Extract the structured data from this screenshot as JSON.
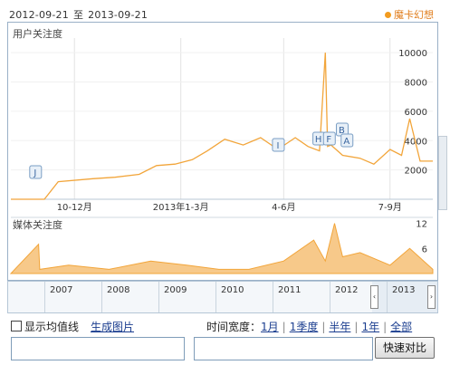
{
  "header": {
    "date_from": "2012-09-21",
    "date_sep": "至",
    "date_to": "2013-09-21",
    "keyword": "魔卡幻想"
  },
  "user_chart": {
    "title": "用户关注度",
    "y_ticks": [
      "10000",
      "8000",
      "6000",
      "4000",
      "2000"
    ],
    "x_ticks": [
      "10-12月",
      "2013年1-3月",
      "4-6月",
      "7-9月"
    ],
    "markers": [
      "J",
      "I",
      "H",
      "F",
      "B",
      "A"
    ]
  },
  "media_chart": {
    "title": "媒体关注度",
    "y_ticks": [
      "12",
      "6"
    ]
  },
  "overview": {
    "years": [
      "2007",
      "2008",
      "2009",
      "2010",
      "2011",
      "2012",
      "2013"
    ]
  },
  "controls": {
    "show_avg": "显示均值线",
    "gen_image": "生成图片",
    "time_width_label": "时间宽度：",
    "ranges": [
      "1月",
      "1季度",
      "半年",
      "1年",
      "全部"
    ],
    "compare_btn": "快速对比",
    "input1_value": "",
    "input2_value": ""
  },
  "chart_data": [
    {
      "type": "line",
      "title": "用户关注度",
      "ylim": [
        0,
        11000
      ],
      "y_ticks": [
        2000,
        4000,
        6000,
        8000,
        10000
      ],
      "x_ticks": [
        "10-12月",
        "2013年1-3月",
        "4-6月",
        "7-9月"
      ],
      "x": [
        "2012-09-21",
        "2012-10-10",
        "2012-10-20",
        "2012-11-01",
        "2012-12-01",
        "2012-12-20",
        "2013-01-10",
        "2013-01-25",
        "2013-02-10",
        "2013-02-25",
        "2013-03-10",
        "2013-03-25",
        "2013-04-10",
        "2013-04-25",
        "2013-05-10",
        "2013-05-25",
        "2013-06-05",
        "2013-06-15",
        "2013-06-20",
        "2013-06-22",
        "2013-06-25",
        "2013-07-05",
        "2013-07-20",
        "2013-08-01",
        "2013-08-15",
        "2013-08-25",
        "2013-09-01",
        "2013-09-10",
        "2013-09-21"
      ],
      "series": [
        {
          "values": [
            0,
            0,
            0,
            1200,
            1400,
            1500,
            1700,
            2300,
            2400,
            2700,
            3300,
            4100,
            3700,
            4200,
            3400,
            4200,
            3600,
            3300,
            10000,
            3600,
            3700,
            3000,
            2800,
            2400,
            3400,
            3000,
            5500,
            2600,
            2600
          ]
        }
      ],
      "markers": [
        {
          "label": "J",
          "x": "2012-10-12"
        },
        {
          "label": "I",
          "x": "2013-05-10"
        },
        {
          "label": "H",
          "x": "2013-06-14"
        },
        {
          "label": "F",
          "x": "2013-06-20"
        },
        {
          "label": "B",
          "x": "2013-06-28"
        },
        {
          "label": "A",
          "x": "2013-06-29"
        }
      ]
    },
    {
      "type": "area",
      "title": "媒体关注度",
      "ylim": [
        0,
        13
      ],
      "y_ticks": [
        6,
        12
      ],
      "x": [
        "2012-09-21",
        "2012-10-15",
        "2012-10-16",
        "2012-11-10",
        "2012-12-15",
        "2013-01-20",
        "2013-02-20",
        "2013-03-20",
        "2013-04-15",
        "2013-05-15",
        "2013-06-10",
        "2013-06-20",
        "2013-06-28",
        "2013-07-05",
        "2013-07-20",
        "2013-08-15",
        "2013-09-01",
        "2013-09-21"
      ],
      "series": [
        {
          "values": [
            0,
            7,
            1,
            2,
            1,
            3,
            2,
            1,
            1,
            3,
            8,
            3,
            12,
            4,
            5,
            2,
            6,
            1
          ]
        }
      ]
    }
  ]
}
